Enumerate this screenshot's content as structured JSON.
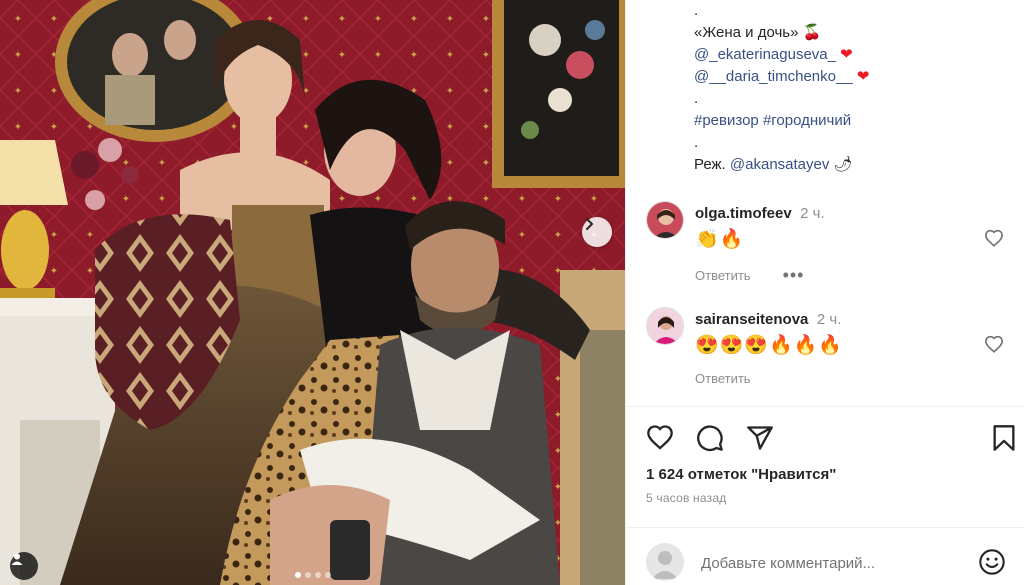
{
  "caption": {
    "top_dot": ".",
    "title": "«Жена и дочь»",
    "title_emoji": "🍒",
    "mention_1": "@_ekaterinaguseva_",
    "mention_1_emoji": "❤",
    "mention_2": "@__daria_timchenko__",
    "mention_2_emoji": "❤",
    "dot_1": ".",
    "hashtag_1": "#ревизор",
    "hashtag_2": "#городничий",
    "dot_2": ".",
    "director_label": "Реж.",
    "director_mention": "@akansatayev",
    "director_emoji": "🌶"
  },
  "comments": [
    {
      "user": "olga.timofeev",
      "time": "2 ч.",
      "text": "👏🔥",
      "reply": "Ответить",
      "more": "•••"
    },
    {
      "user": "sairanseitenova",
      "time": "2 ч.",
      "text": "😍😍😍🔥🔥🔥",
      "reply": "Ответить"
    }
  ],
  "likes_text": "1 624 отметок \"Нравится\"",
  "posted_time": "5 часов назад",
  "add_comment": {
    "placeholder": "Добавьте комментарий..."
  },
  "icons": {
    "like": "heart-icon",
    "comment": "comment-icon",
    "share": "paper-plane-icon",
    "save": "bookmark-icon",
    "next": "chevron-right-icon",
    "tag": "user-tag-icon",
    "emoji": "smiley-icon"
  },
  "colors": {
    "link": "#385185",
    "secondary_text": "#8e8e8e",
    "wall": "#8b1a28"
  }
}
